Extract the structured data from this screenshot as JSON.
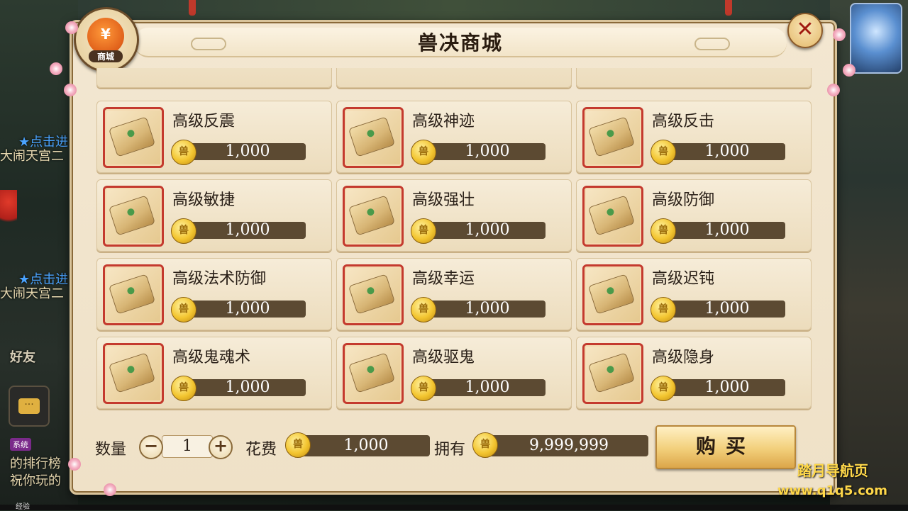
{
  "shop": {
    "title": "兽决商城",
    "badge_icon": "¥",
    "badge_label": "商城",
    "close_icon": "✕"
  },
  "background": {
    "side_texts": [
      "★点击进",
      "大闹天宫二",
      "★点击进",
      "大闹天宫二"
    ],
    "friend_label": "好友",
    "chat_icon": "···",
    "system_badge": "系统",
    "system_text_1": "的排行榜",
    "system_text_2": "祝你玩的",
    "exp_label": "经验"
  },
  "items": [
    {
      "name": "高级反震",
      "price": "1,000"
    },
    {
      "name": "高级神迹",
      "price": "1,000"
    },
    {
      "name": "高级反击",
      "price": "1,000"
    },
    {
      "name": "高级敏捷",
      "price": "1,000"
    },
    {
      "name": "高级强壮",
      "price": "1,000"
    },
    {
      "name": "高级防御",
      "price": "1,000"
    },
    {
      "name": "高级法术防御",
      "price": "1,000"
    },
    {
      "name": "高级幸运",
      "price": "1,000"
    },
    {
      "name": "高级迟钝",
      "price": "1,000"
    },
    {
      "name": "高级鬼魂术",
      "price": "1,000"
    },
    {
      "name": "高级驱鬼",
      "price": "1,000"
    },
    {
      "name": "高级隐身",
      "price": "1,000"
    }
  ],
  "coin_icon": "兽",
  "purchase": {
    "quantity_label": "数量",
    "minus": "−",
    "quantity": "1",
    "plus": "+",
    "cost_label": "花费",
    "cost": "1,000",
    "owned_label": "拥有",
    "owned": "9,999,999",
    "buy_label": "购买"
  },
  "watermark": {
    "line1": "踏月导航页",
    "line2": "www.q1q5.com"
  }
}
